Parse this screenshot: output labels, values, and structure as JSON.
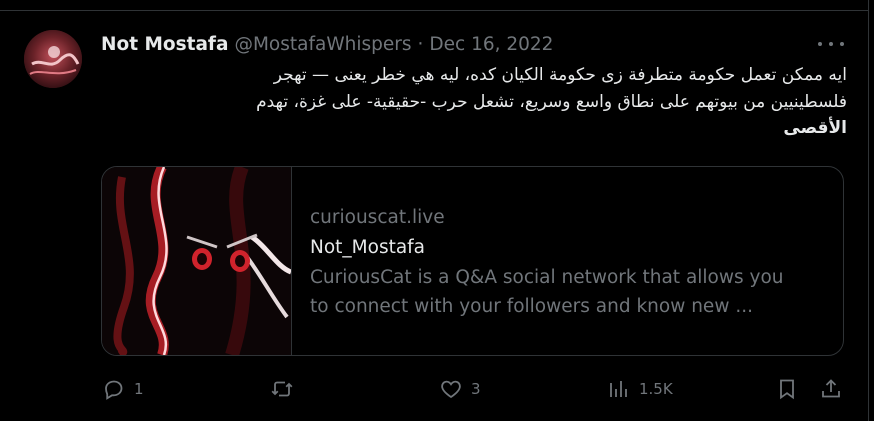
{
  "tweet": {
    "author_name": "Not Mostafa",
    "handle": "@MostafaWhispers",
    "separator": "·",
    "date": "Dec 16, 2022",
    "text_line1": "ايه ممكن تعمل حكومة متطرفة زى حكومة الكيان كده، ليه هي خطر يعنى — تهجر",
    "text_line2": "فلسطينيين من بيوتهم على نطاق واسع وسريع، تشعل حرب -حقيقية- على غزة، تهدم",
    "text_bold": "الأقصى"
  },
  "card": {
    "domain": "curiouscat.live",
    "title": "Not_Mostafa",
    "description_line1": "CuriousCat is a Q&A social network that allows you",
    "description_line2": "to connect with your followers and know new ..."
  },
  "actions": {
    "reply_count": "1",
    "retweet_count": "",
    "like_count": "3",
    "views_count": "1.5K"
  },
  "icons": {
    "more": "more-horizontal-icon",
    "reply": "reply-icon",
    "retweet": "retweet-icon",
    "like": "heart-icon",
    "views": "analytics-icon",
    "bookmark": "bookmark-icon",
    "share": "share-icon"
  },
  "colors": {
    "background": "#000000",
    "text": "#e7e9ea",
    "muted": "#71767b",
    "border": "#2f3336"
  }
}
